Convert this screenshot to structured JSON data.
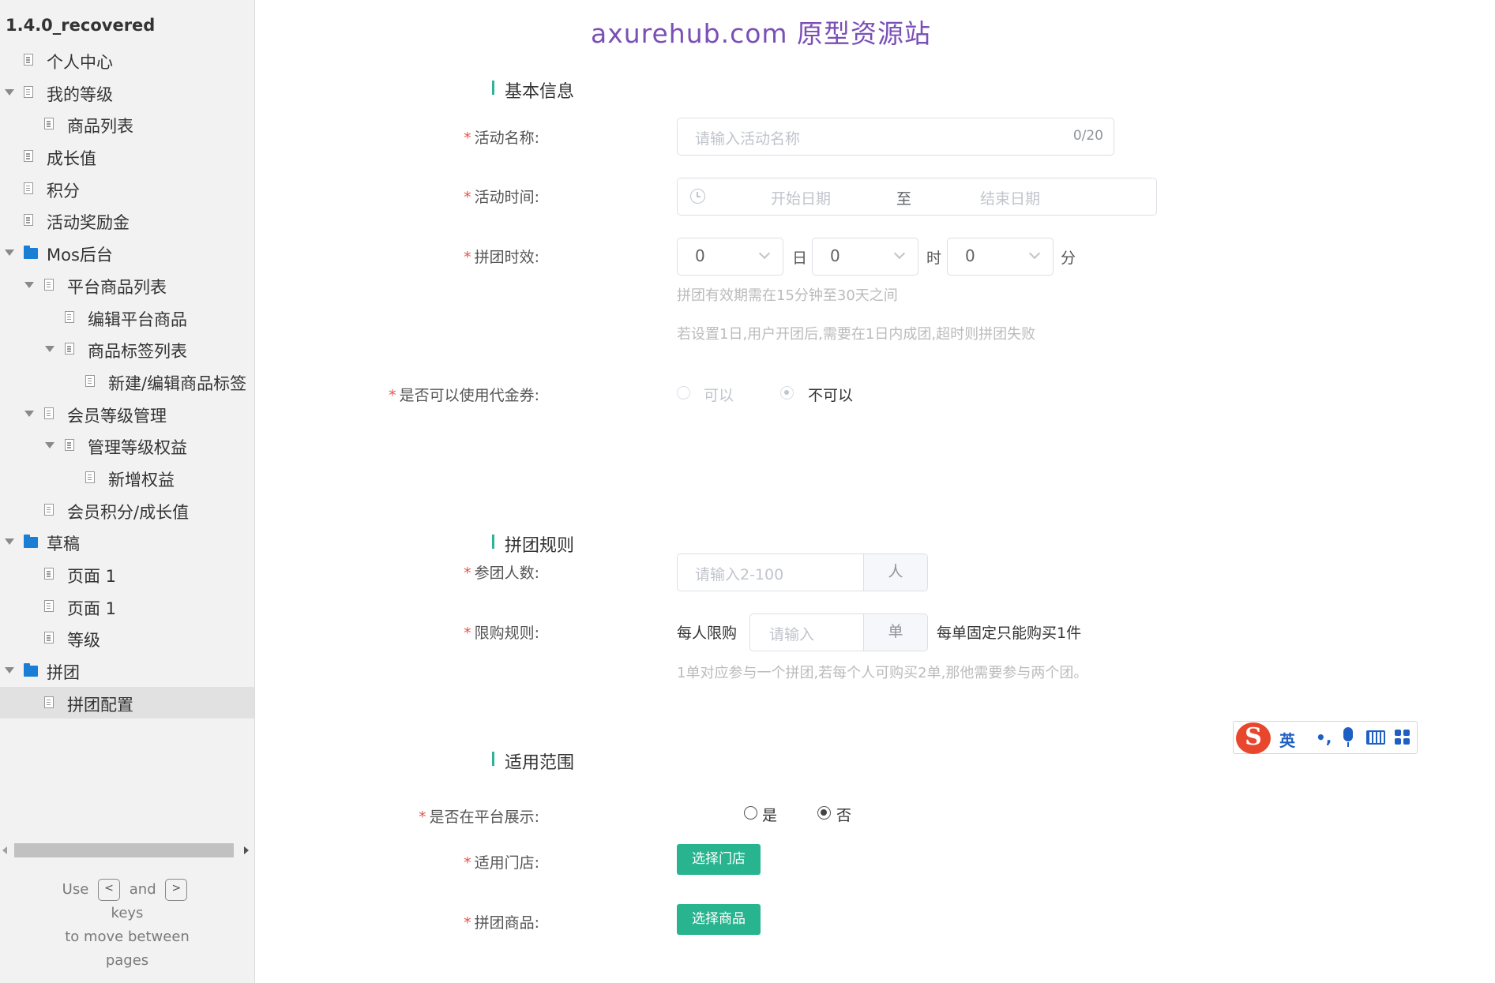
{
  "sidebar": {
    "project_title": "1.4.0_recovered",
    "items": [
      {
        "label": "个人中心",
        "icon": "page-icon",
        "level": 1,
        "caret": false
      },
      {
        "label": "我的等级",
        "icon": "page-icon",
        "level": 1,
        "caret": true
      },
      {
        "label": "商品列表",
        "icon": "page-icon",
        "level": 2,
        "caret": false
      },
      {
        "label": "成长值",
        "icon": "page-icon",
        "level": 1,
        "caret": false
      },
      {
        "label": "积分",
        "icon": "page-icon",
        "level": 1,
        "caret": false
      },
      {
        "label": "活动奖励金",
        "icon": "page-icon",
        "level": 1,
        "caret": false
      },
      {
        "label": "Mos后台",
        "icon": "folder-icon",
        "level": 1,
        "caret": true
      },
      {
        "label": "平台商品列表",
        "icon": "page-icon",
        "level": 2,
        "caret": true
      },
      {
        "label": "编辑平台商品",
        "icon": "page-icon",
        "level": 3,
        "caret": false
      },
      {
        "label": "商品标签列表",
        "icon": "page-icon",
        "level": 3,
        "caret": true
      },
      {
        "label": "新建/编辑商品标签",
        "icon": "page-icon",
        "level": 4,
        "caret": false
      },
      {
        "label": "会员等级管理",
        "icon": "page-icon",
        "level": 2,
        "caret": true
      },
      {
        "label": "管理等级权益",
        "icon": "page-icon",
        "level": 3,
        "caret": true
      },
      {
        "label": "新增权益",
        "icon": "page-icon",
        "level": 4,
        "caret": false
      },
      {
        "label": "会员积分/成长值",
        "icon": "page-icon",
        "level": 2,
        "caret": false
      },
      {
        "label": "草稿",
        "icon": "folder-icon",
        "level": 1,
        "caret": true
      },
      {
        "label": "页面 1",
        "icon": "page-icon",
        "level": 2,
        "caret": false
      },
      {
        "label": "页面 1",
        "icon": "page-icon",
        "level": 2,
        "caret": false
      },
      {
        "label": "等级",
        "icon": "page-icon",
        "level": 2,
        "caret": false
      },
      {
        "label": "拼团",
        "icon": "folder-icon",
        "level": 1,
        "caret": true
      },
      {
        "label": "拼团配置",
        "icon": "page-icon",
        "level": 2,
        "caret": false,
        "selected": true
      }
    ],
    "hint": {
      "use": "Use",
      "key_prev": "<",
      "and": "and",
      "key_next": ">",
      "keys": "keys",
      "line2": "to move between",
      "line3": "pages"
    }
  },
  "watermark": "axurehub.com 原型资源站",
  "basic_info": {
    "title": "基本信息",
    "required_mark": "*",
    "name_label": "活动名称:",
    "name_placeholder": "请输入活动名称",
    "name_counter": "0/20",
    "time_label": "活动时间:",
    "time_start_placeholder": "开始日期",
    "time_separator": "至",
    "time_end_placeholder": "结束日期",
    "validity_label": "拼团时效:",
    "day_value": "0",
    "day_unit": "日",
    "hour_value": "0",
    "hour_unit": "时",
    "minute_value": "0",
    "minute_unit": "分",
    "validity_note_1": "拼团有效期需在15分钟至30天之间",
    "validity_note_2": "若设置1日,用户开团后,需要在1日内成团,超时则拼团失败",
    "coupon_label": "是否可以使用代金券:",
    "coupon_option_yes": "可以",
    "coupon_option_no": "不可以",
    "coupon_selected": "不可以"
  },
  "rules": {
    "title": "拼团规则",
    "participants_label": "参团人数:",
    "participants_placeholder": "请输入2-100",
    "participants_unit": "人",
    "limit_label": "限购规则:",
    "limit_prefix": "每人限购",
    "limit_placeholder": "请输入",
    "limit_unit": "单",
    "limit_suffix": "每单固定只能购买1件",
    "limit_note": "1单对应参与一个拼团,若每个人可购买2单,那他需要参与两个团。"
  },
  "scope": {
    "title": "适用范围",
    "platform_label": "是否在平台展示:",
    "platform_yes": "是",
    "platform_no": "否",
    "platform_selected": "否",
    "store_label": "适用门店:",
    "store_button": "选择门店",
    "product_label": "拼团商品:",
    "product_button": "选择商品"
  },
  "ime": {
    "logo": "S",
    "mode": "英",
    "punct": "•,",
    "icons": [
      "microphone-icon",
      "keyboard-icon",
      "apps-grid-icon"
    ]
  },
  "colors": {
    "accent_green": "#27b48f",
    "required_red": "#e5534b",
    "folder_blue": "#1a7fd4",
    "watermark_purple": "#7a4fb6"
  }
}
